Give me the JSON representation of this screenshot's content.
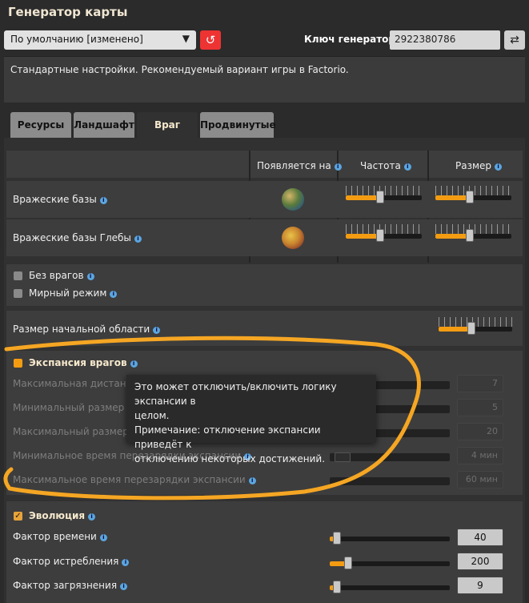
{
  "window": {
    "title": "Генератор карты"
  },
  "preset": {
    "value": "По умолчанию [изменено]"
  },
  "seed": {
    "label": "Ключ генератора",
    "value": "2922380786"
  },
  "description": "Стандартные настройки. Рекомендуемый вариант игры в Factorio.",
  "tabs": [
    {
      "label": "Ресурсы"
    },
    {
      "label": "Ландшафт"
    },
    {
      "label": "Враг"
    },
    {
      "label": "Продвинутые"
    }
  ],
  "table": {
    "headers": {
      "appears": "Появляется на",
      "frequency": "Частота",
      "size": "Размер"
    },
    "rows": [
      {
        "label": "Вражеские базы",
        "frequency": 0.45,
        "size": 0.45
      },
      {
        "label": "Вражеские базы Глебы",
        "frequency": 0.45,
        "size": 0.45
      }
    ]
  },
  "options": {
    "no_enemies": "Без врагов",
    "peaceful": "Мирный режим",
    "starting_area": {
      "label": "Размер начальной области",
      "level": 0.45
    }
  },
  "expansion": {
    "label": "Экспансия врагов",
    "enabled": false,
    "settings": [
      {
        "label": "Максимальная дистанция",
        "value": "7"
      },
      {
        "label": "Минимальный размер гру",
        "value": "5"
      },
      {
        "label": "Максимальный размер гр",
        "value": "20"
      },
      {
        "label": "Минимальное время перезарядки экспансии",
        "value": "4 мин"
      },
      {
        "label": "Максимальное время перезарядки экспансии",
        "value": "60 мин"
      }
    ]
  },
  "tooltip": {
    "line1": "Это может отключить/включить логику экспансии в",
    "line2": "целом.",
    "line3": "Примечание: отключение экспансии приведёт к",
    "line4": "отключению некоторых достижений."
  },
  "evolution": {
    "label": "Эволюция",
    "enabled": true,
    "settings": [
      {
        "label": "Фактор времени",
        "value": "40",
        "level": 0.06
      },
      {
        "label": "Фактор истребления",
        "value": "200",
        "level": 0.15
      },
      {
        "label": "Фактор загрязнения",
        "value": "9",
        "level": 0.06
      }
    ]
  },
  "colors": {
    "accent": "#f39c12",
    "highlight_ring": "#f5a623",
    "reset": "#e33333"
  }
}
